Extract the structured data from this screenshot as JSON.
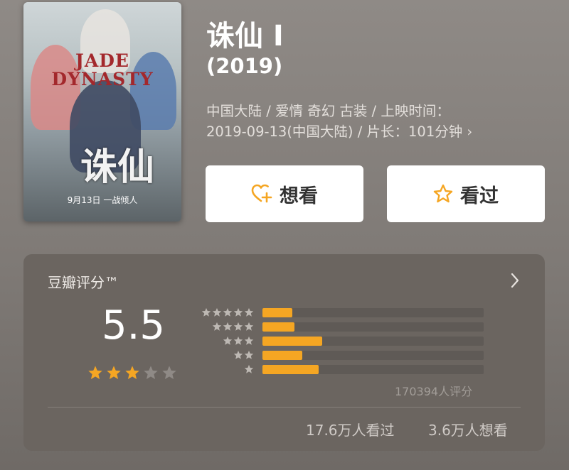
{
  "movie": {
    "title": "诛仙 I",
    "year": "(2019)",
    "info_line1": "中国大陆 / 爱情 奇幻 古装 / 上映时间：",
    "info_line2": "2019-09-13(中国大陆) / 片长：101分钟 ›",
    "poster": {
      "title_line1": "JADE",
      "title_line2": "DYNASTY",
      "big_text": "诛仙",
      "date_text": "9月13日 一战倾人"
    }
  },
  "actions": {
    "want_label": "想看",
    "seen_label": "看过",
    "accent_color": "#f5a623"
  },
  "rating": {
    "label": "豆瓣评分™",
    "score": "5.5",
    "stars_filled": 3,
    "stars_total": 5,
    "distribution": [
      {
        "stars": 5,
        "fraction": 0.136
      },
      {
        "stars": 4,
        "fraction": 0.145
      },
      {
        "stars": 3,
        "fraction": 0.27
      },
      {
        "stars": 2,
        "fraction": 0.18
      },
      {
        "stars": 1,
        "fraction": 0.255
      }
    ],
    "votes": "170394人评分",
    "seen_count": "17.6万人看过",
    "want_count": "3.6万人想看"
  }
}
